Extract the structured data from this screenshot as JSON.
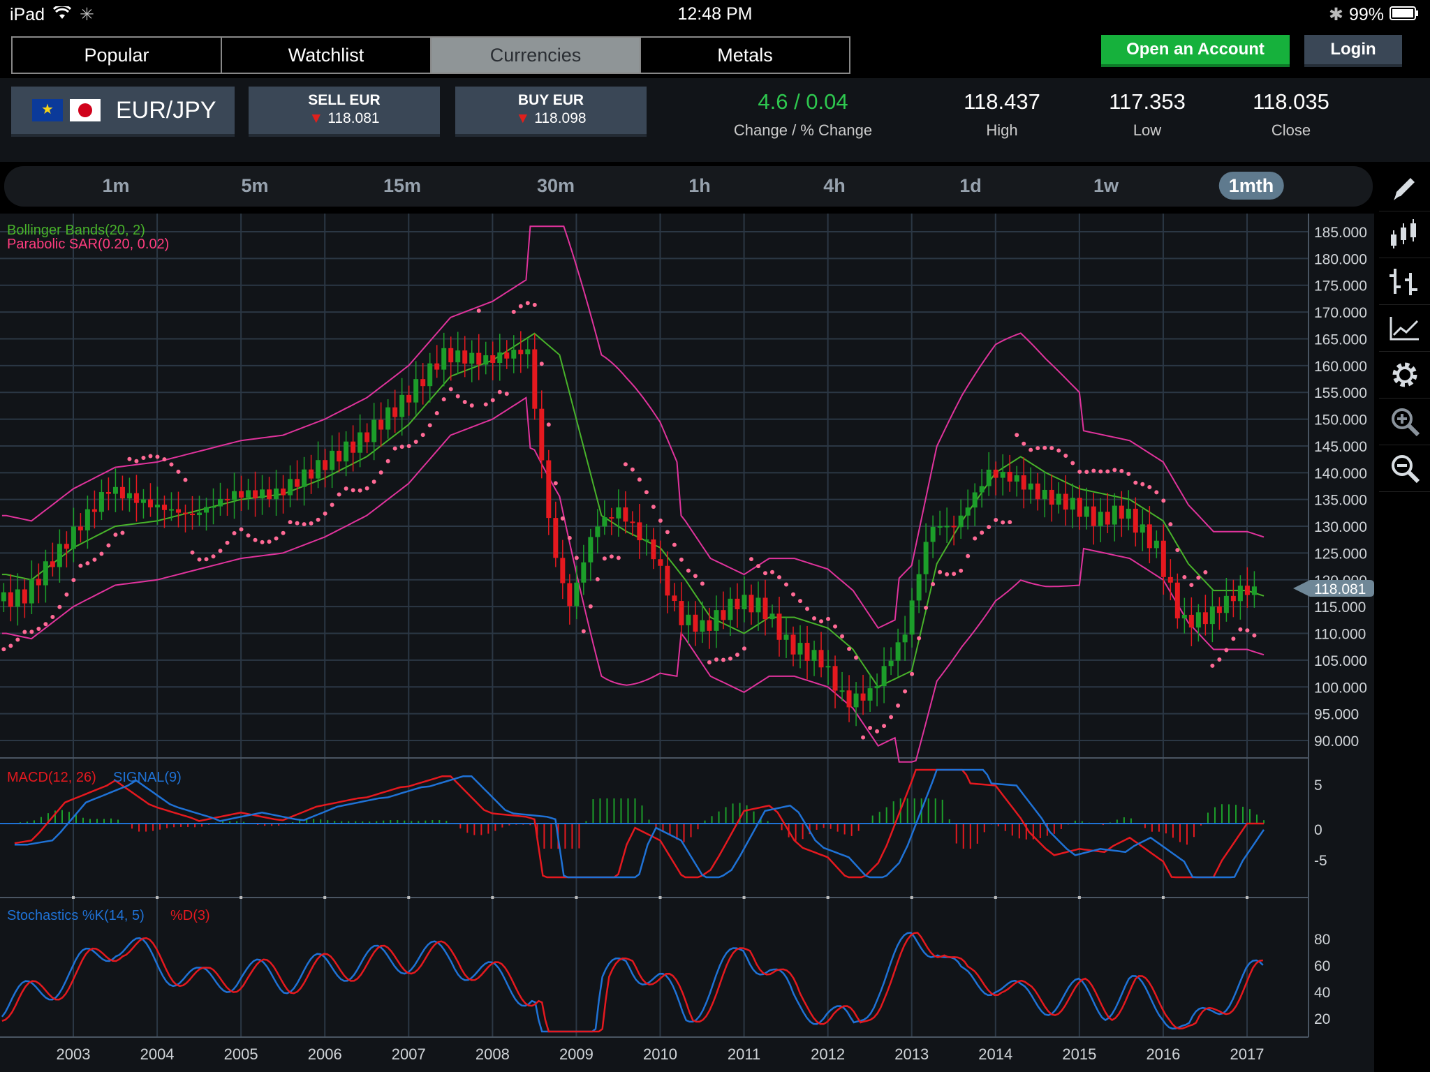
{
  "status": {
    "device": "iPad",
    "time": "12:48 PM",
    "battery": "99%"
  },
  "tabs": [
    {
      "label": "Popular",
      "active": false
    },
    {
      "label": "Watchlist",
      "active": false
    },
    {
      "label": "Currencies",
      "active": true
    },
    {
      "label": "Metals",
      "active": false
    }
  ],
  "header": {
    "open_account": "Open an Account",
    "login": "Login"
  },
  "quote": {
    "pair": "EUR/JPY",
    "sell_label": "SELL EUR",
    "sell_price": "118.081",
    "buy_label": "BUY EUR",
    "buy_price": "118.098",
    "change_value": "4.6 / 0.04",
    "change_label": "Change / % Change",
    "high_value": "118.437",
    "high_label": "High",
    "low_value": "117.353",
    "low_label": "Low",
    "close_value": "118.035",
    "close_label": "Close",
    "change_color": "#2ec84f"
  },
  "timeframes": [
    {
      "label": "1m"
    },
    {
      "label": "5m"
    },
    {
      "label": "15m"
    },
    {
      "label": "30m"
    },
    {
      "label": "1h"
    },
    {
      "label": "4h"
    },
    {
      "label": "1d"
    },
    {
      "label": "1w"
    },
    {
      "label": "1mth",
      "active": true
    }
  ],
  "tools": [
    "pencil-icon",
    "candlestick-icon",
    "ohlc-icon",
    "line-chart-icon",
    "gear-icon",
    "zoom-in-icon",
    "zoom-out-icon"
  ],
  "chart_data": {
    "type": "line",
    "title": "EUR/JPY",
    "current_price": "118.081",
    "x_ticks": [
      "2003",
      "2004",
      "2005",
      "2006",
      "2007",
      "2008",
      "2009",
      "2010",
      "2011",
      "2012",
      "2013",
      "2014",
      "2015",
      "2016",
      "2017"
    ],
    "main": {
      "indicators": [
        "Bollinger Bands(20, 2)",
        "Parabolic SAR(0.20, 0.02)"
      ],
      "y_ticks": [
        "185.000",
        "180.000",
        "175.000",
        "170.000",
        "165.000",
        "160.000",
        "155.000",
        "150.000",
        "145.000",
        "140.000",
        "135.000",
        "130.000",
        "125.000",
        "120.000",
        "115.000",
        "110.000",
        "105.000",
        "100.000",
        "95.000",
        "90.000"
      ],
      "ylim": [
        88,
        187
      ],
      "x": [
        2002.2,
        2002.5,
        2003,
        2003.5,
        2004,
        2004.5,
        2005,
        2005.5,
        2006,
        2006.5,
        2007,
        2007.5,
        2008,
        2008.5,
        2008.8,
        2009,
        2009.3,
        2009.6,
        2010,
        2010.3,
        2010.6,
        2011,
        2011.3,
        2011.6,
        2012,
        2012.3,
        2012.6,
        2013,
        2013.3,
        2013.6,
        2014,
        2014.3,
        2014.6,
        2015,
        2015.3,
        2015.6,
        2016,
        2016.3,
        2016.6,
        2017,
        2017.2
      ],
      "series": [
        {
          "name": "Price",
          "values": [
            116,
            117,
            127,
            137,
            134,
            132,
            136,
            136,
            141,
            146,
            153,
            162,
            161,
            163,
            126,
            115,
            130,
            133,
            125,
            113,
            111,
            116,
            115,
            108,
            105,
            97,
            99,
            110,
            130,
            130,
            140,
            139,
            136,
            134,
            131,
            133,
            126,
            112,
            113,
            118,
            118
          ]
        },
        {
          "name": "Bollinger Band",
          "values": [
            121,
            120,
            126,
            130,
            131,
            133,
            135,
            136,
            139,
            143,
            149,
            158,
            161,
            166,
            162,
            150,
            132,
            129,
            126,
            120,
            113,
            110,
            113,
            113,
            111,
            107,
            100,
            103,
            123,
            131,
            140,
            143,
            140,
            137,
            136,
            135,
            131,
            123,
            118,
            118,
            117
          ]
        }
      ]
    },
    "macd": {
      "label": "MACD(12, 26)",
      "signal_label": "SIGNAL(9)",
      "y_ticks": [
        "5",
        "0",
        "-5"
      ]
    },
    "stoch": {
      "label": "Stochastics %K(14, 5)",
      "d_label": "%D(3)",
      "y_ticks": [
        "80",
        "60",
        "40",
        "20"
      ]
    },
    "colors": {
      "up": "#1c9e2a",
      "down": "#e5191f",
      "bb": "#e0339c",
      "mid": "#48b32a",
      "sar": "#ff6a95",
      "macd": "#e5191f",
      "signal": "#1f72d6",
      "grid": "#2b3744"
    }
  }
}
